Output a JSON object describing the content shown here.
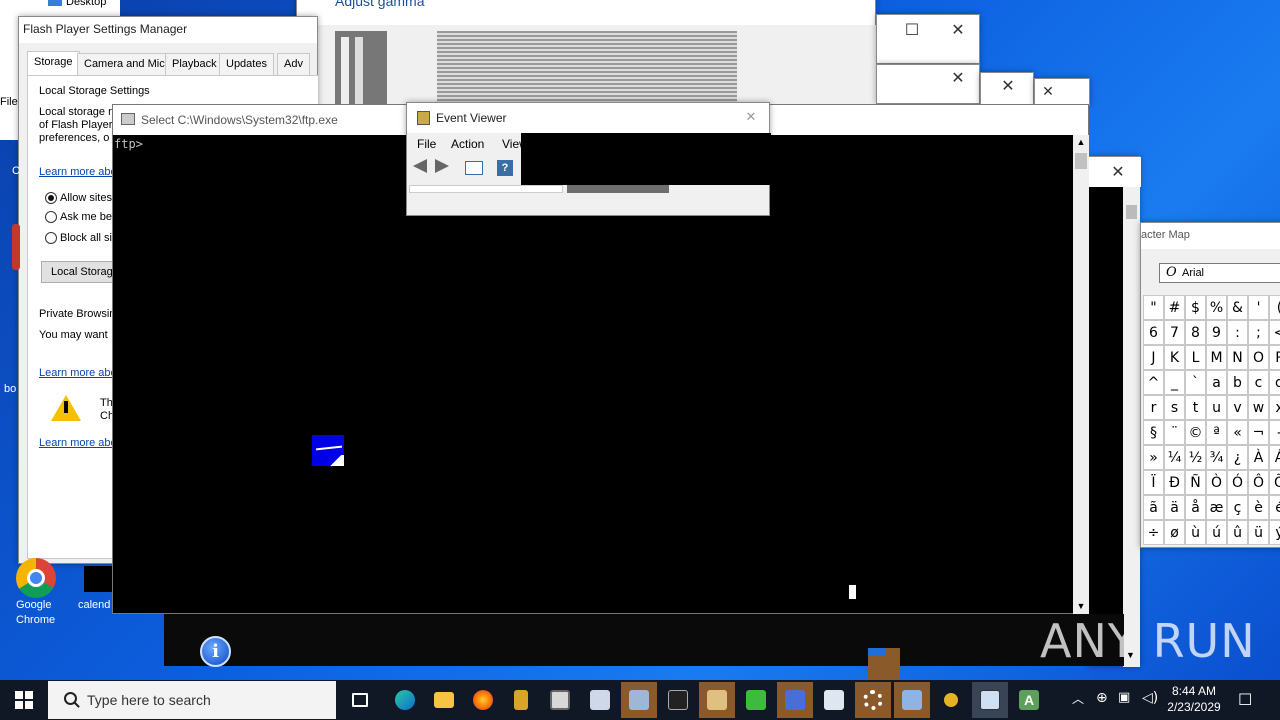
{
  "desktop": {
    "explorer_item_desktop": "Desktop",
    "file_fragment": "File",
    "icons": [
      {
        "label_line1": "Google",
        "label_line2": "Chrome"
      },
      {
        "label_line1": "calend",
        "label_line2": ""
      }
    ],
    "side_fragments": [
      "C",
      "bo"
    ]
  },
  "adjust_window": {
    "title_fragment": "Adjust gamma"
  },
  "flash": {
    "title": "Flash Player Settings Manager",
    "tabs": [
      "Storage",
      "Camera and Mic",
      "Playback",
      "Updates",
      "Adv"
    ],
    "section_title": "Local Storage Settings",
    "desc_line1": "Local storage n",
    "desc_line2": "of Flash Player",
    "desc_line3": "preferences, o",
    "learn_more": "Learn more abo",
    "radio_allow": "Allow sites",
    "radio_ask": "Ask me bef",
    "radio_block": "Block all sit",
    "local_storage_button": "Local Storag",
    "private_title": "Private Browsin",
    "private_desc": "You may want",
    "warn_line1": "Th",
    "warn_line2": "Ch"
  },
  "ftp": {
    "title": "Select C:\\Windows\\System32\\ftp.exe",
    "prompt": "ftp>"
  },
  "event_viewer": {
    "title": "Event Viewer",
    "menu": [
      "File",
      "Action",
      "View"
    ]
  },
  "charmap": {
    "title_fragment": "acter Map",
    "font": "Arial",
    "rows": [
      [
        "\"",
        "#",
        "$",
        "%",
        "&",
        "'",
        "("
      ],
      [
        "6",
        "7",
        "8",
        "9",
        ":",
        ";",
        "<"
      ],
      [
        "J",
        "K",
        "L",
        "M",
        "N",
        "O",
        "P"
      ],
      [
        "^",
        "_",
        "`",
        "a",
        "b",
        "c",
        "d"
      ],
      [
        "r",
        "s",
        "t",
        "u",
        "v",
        "w",
        "x"
      ],
      [
        "§",
        "¨",
        "©",
        "ª",
        "«",
        "¬",
        "-"
      ],
      [
        "»",
        "¼",
        "½",
        "¾",
        "¿",
        "À",
        "Á"
      ],
      [
        "Ï",
        "Ð",
        "Ñ",
        "Ò",
        "Ó",
        "Ô",
        "Õ"
      ],
      [
        "ã",
        "ä",
        "å",
        "æ",
        "ç",
        "è",
        "é"
      ],
      [
        "÷",
        "ø",
        "ù",
        "ú",
        "û",
        "ü",
        "ý"
      ]
    ]
  },
  "taskbar": {
    "search_placeholder": "Type here to search",
    "time": "8:44 AM",
    "date": "2/23/2029"
  },
  "watermark": "ANY RUN",
  "colors": {
    "desktop_blue": "#0c5fe0",
    "taskbar": "#101725",
    "console_bg": "#000000",
    "link": "#0645ad"
  }
}
